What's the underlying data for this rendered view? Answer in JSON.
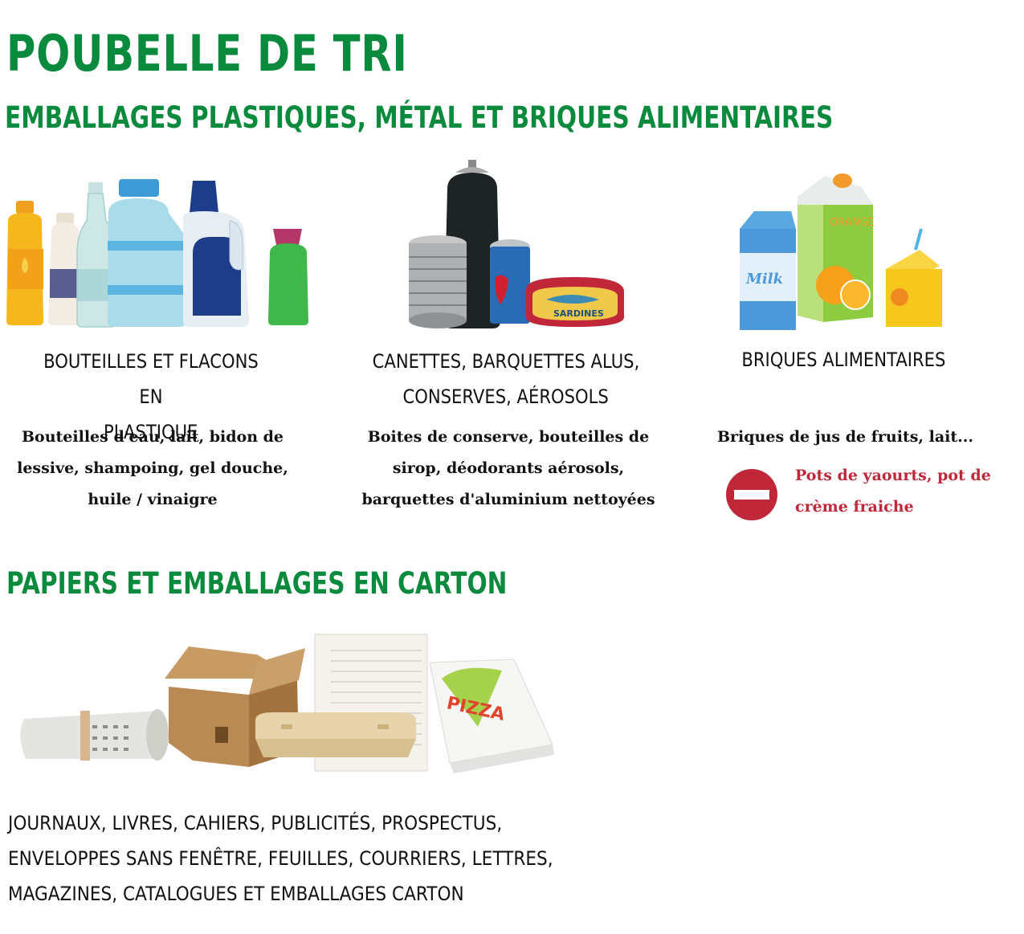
{
  "colors": {
    "green": "#0a8a3c",
    "warning_red": "#c0283a"
  },
  "title": "POUBELLE DE TRI",
  "section1": {
    "title": "EMBALLAGES PLASTIQUES, MÉTAL ET BRIQUES ALIMENTAIRES",
    "categories": [
      {
        "illustration": "plastic-bottles-illustration",
        "title_lines": [
          "BOUTEILLES ET FLACONS EN",
          "PLASTIQUE"
        ],
        "desc_lines": [
          "Bouteilles d'eau, lait, bidon de",
          "lessive, shampoing, gel douche,",
          "huile / vinaigre"
        ]
      },
      {
        "illustration": "metal-cans-illustration",
        "title_lines": [
          "CANETTES, BARQUETTES ALUS,",
          "CONSERVES, AÉROSOLS"
        ],
        "desc_lines": [
          "Boites de conserve, bouteilles de",
          "sirop, déodorants aérosols,",
          "barquettes d'aluminium nettoyées"
        ],
        "illus_labels": {
          "sardines": "SARDINES"
        }
      },
      {
        "illustration": "food-cartons-illustration",
        "title_lines": [
          "BRIQUES ALIMENTAIRES"
        ],
        "desc_lines": [
          "Briques de jus de fruits, lait..."
        ],
        "illus_labels": {
          "milk": "Milk",
          "orange": "ORANGE"
        },
        "warning": {
          "icon": "no-entry-icon",
          "lines": [
            "Pots de yaourts, pot de",
            "crème fraiche"
          ]
        }
      }
    ]
  },
  "section2": {
    "title": "PAPIERS ET EMBALLAGES EN CARTON",
    "illustration": "paper-cardboard-illustration",
    "illus_labels": {
      "pizza": "PIZZA"
    },
    "text_lines": [
      "JOURNAUX, LIVRES, CAHIERS, PUBLICITÉS, PROSPECTUS,",
      "ENVELOPPES SANS FENÊTRE, FEUILLES, COURRIERS, LETTRES,",
      "MAGAZINES, CATALOGUES ET EMBALLAGES CARTON"
    ]
  }
}
